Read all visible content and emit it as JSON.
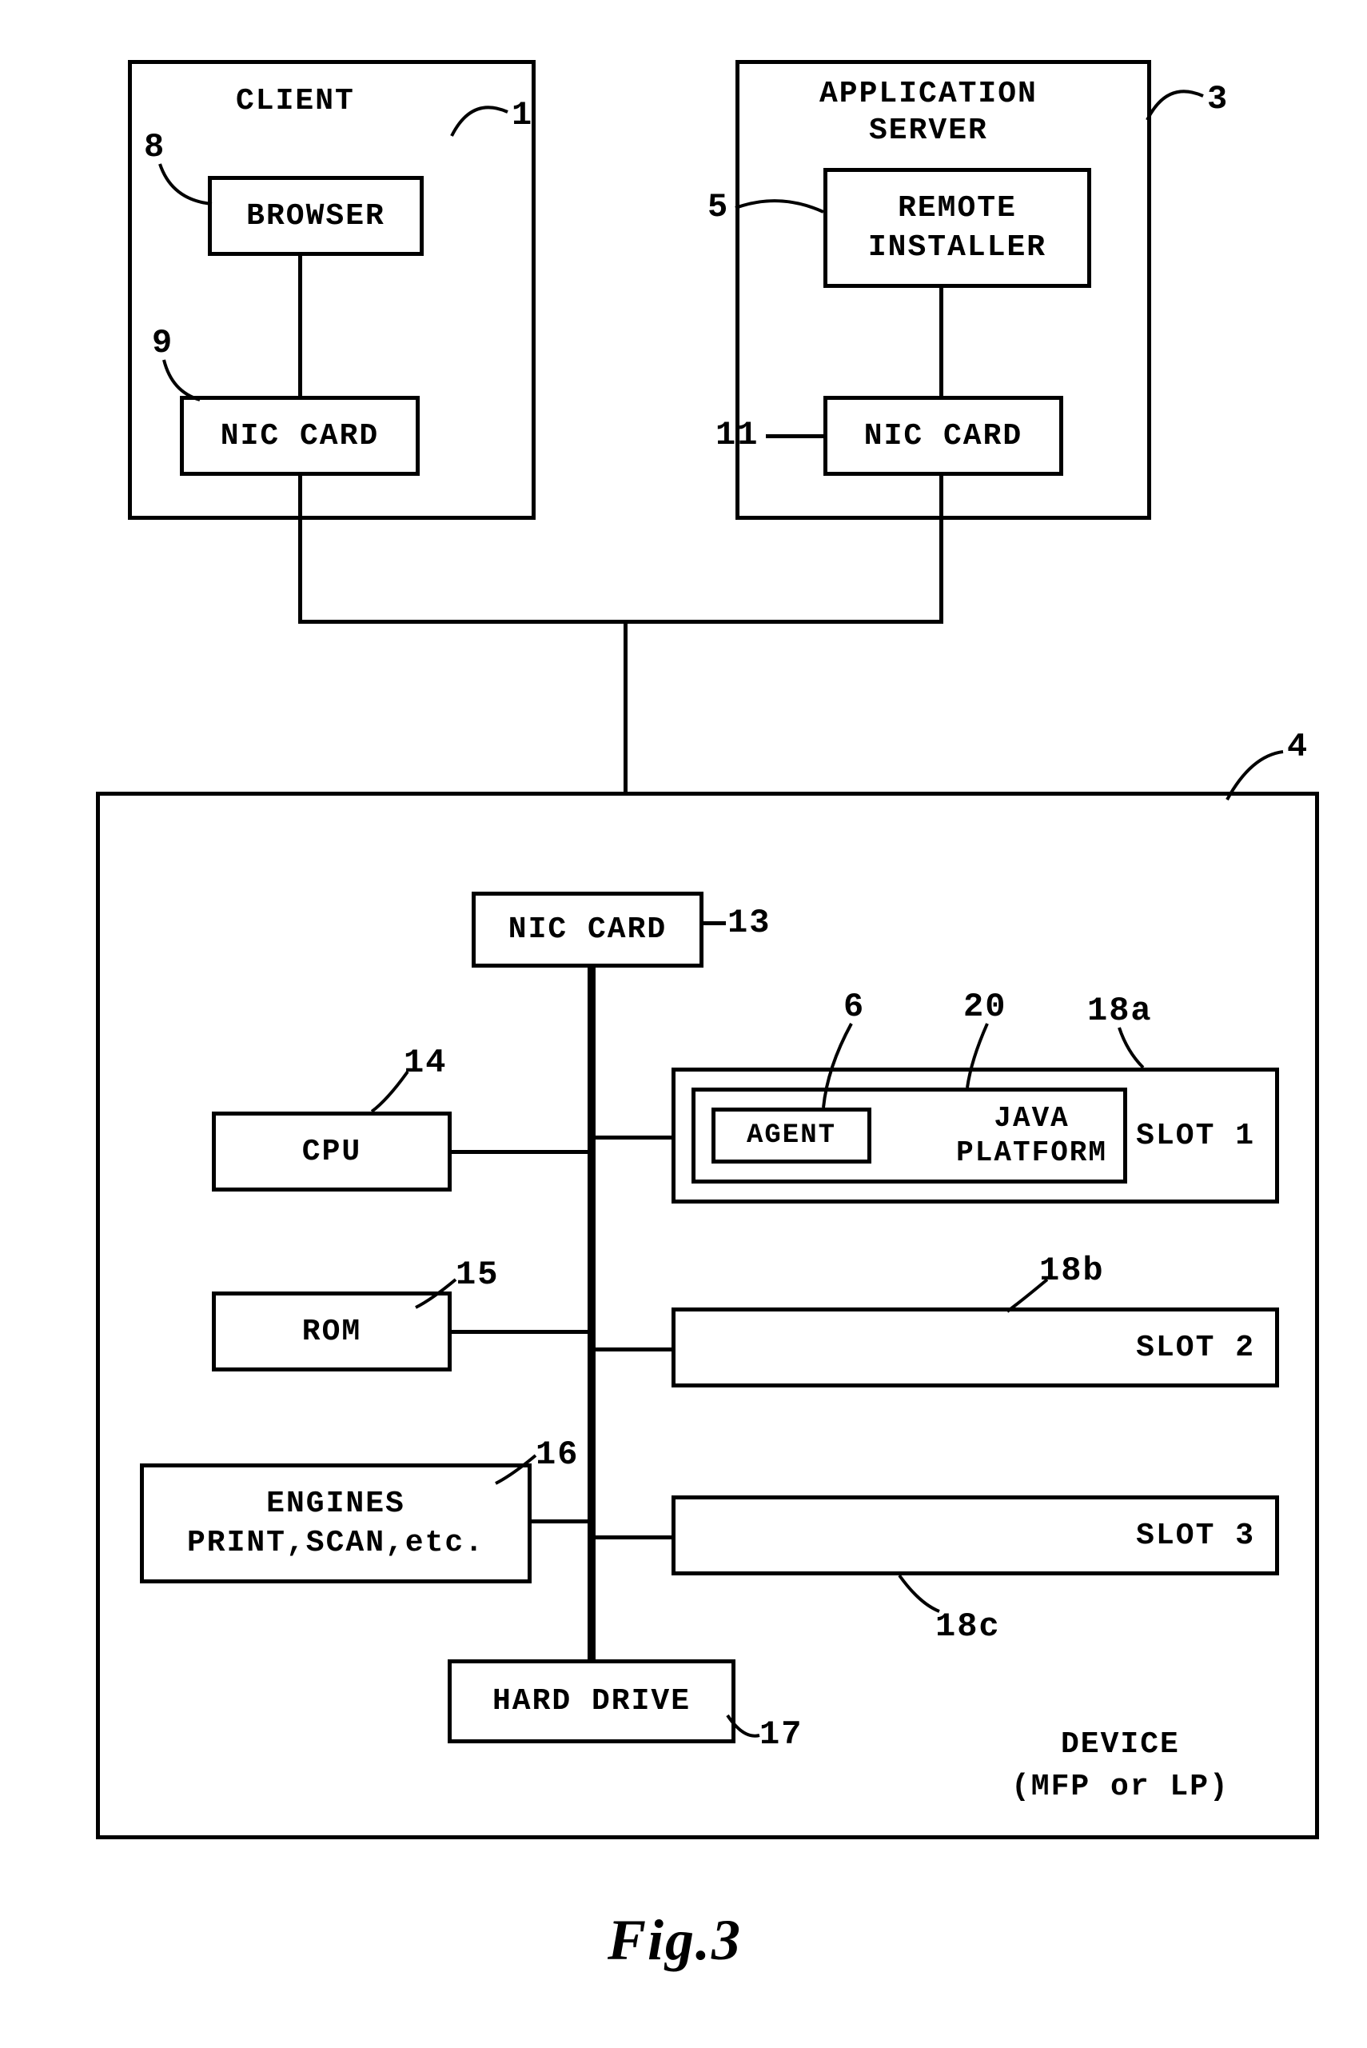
{
  "client": {
    "title": "CLIENT",
    "ref": "1",
    "browser": {
      "label": "BROWSER",
      "ref": "8"
    },
    "nic": {
      "label": "NIC CARD",
      "ref": "9"
    }
  },
  "appserver": {
    "title": "APPLICATION\nSERVER",
    "ref": "3",
    "installer": {
      "label": "REMOTE\nINSTALLER",
      "ref": "5"
    },
    "nic": {
      "label": "NIC CARD",
      "ref": "11"
    }
  },
  "device": {
    "ref": "4",
    "title": "DEVICE\n(MFP or LP)",
    "nic": {
      "label": "NIC CARD",
      "ref": "13"
    },
    "cpu": {
      "label": "CPU",
      "ref": "14"
    },
    "rom": {
      "label": "ROM",
      "ref": "15"
    },
    "engines": {
      "label": "ENGINES\nPRINT,SCAN,etc.",
      "ref": "16"
    },
    "hdd": {
      "label": "HARD DRIVE",
      "ref": "17"
    },
    "slot1": {
      "label": "SLOT 1",
      "ref": "18a"
    },
    "slot2": {
      "label": "SLOT 2",
      "ref": "18b"
    },
    "slot3": {
      "label": "SLOT 3",
      "ref": "18c"
    },
    "java": {
      "label": "JAVA\nPLATFORM",
      "ref": "20"
    },
    "agent": {
      "label": "AGENT",
      "ref": "6"
    }
  },
  "figure": "Fig.3"
}
